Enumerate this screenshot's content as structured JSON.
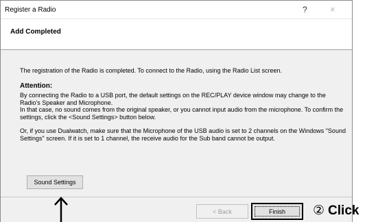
{
  "window": {
    "title": "Register a Radio",
    "help_glyph": "?",
    "close_glyph": "×"
  },
  "header": {
    "title": "Add Completed"
  },
  "content": {
    "intro": "The registration of the Radio is completed. To connect to the Radio, using the Radio List screen.",
    "attention_title": "Attention:",
    "attention_line1": "By connecting the Radio to a USB port, the default settings on the REC/PLAY device window may change to the Radio's Speaker and Microphone.",
    "attention_line2": "In that case, no sound comes from the original speaker, or you cannot input audio from the microphone. To confirm the settings, click the <Sound Settings> button below.",
    "dualwatch": "Or, if you use Dualwatch, make sure that the Microphone of the USB audio is set to 2 channels on the Windows \"Sound Settings\" screen. If it is set to 1 channel, the receive audio for the Sub band cannot be output."
  },
  "buttons": {
    "sound_settings": "Sound Settings",
    "back": "< Back",
    "finish": "Finish"
  },
  "annotations": {
    "callout_number": "②",
    "callout_text": "Click",
    "arrow_icon": "up-arrow-icon"
  }
}
